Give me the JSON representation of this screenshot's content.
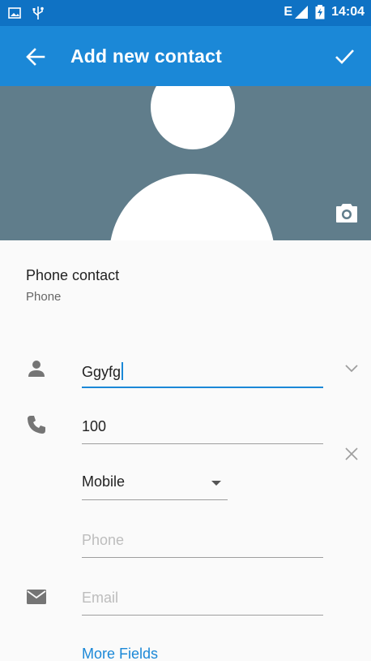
{
  "status_bar": {
    "time": "14:04",
    "network": "E",
    "icons": [
      "image-icon",
      "usb-icon",
      "signal-icon",
      "battery-icon"
    ]
  },
  "app_bar": {
    "title": "Add new contact",
    "back_icon": "arrow-back-icon",
    "save_icon": "check-icon"
  },
  "account": {
    "name": "Phone contact",
    "type": "Phone"
  },
  "form": {
    "name_value": "Ggyfg",
    "phone_value": "100",
    "phone_type": "Mobile",
    "phone2_placeholder": "Phone",
    "email_placeholder": "Email",
    "more_fields": "More Fields"
  },
  "colors": {
    "status_bar": "#0f72c4",
    "app_bar": "#1b88d7",
    "photo_bg": "#607d8b",
    "accent": "#1b88d7"
  }
}
